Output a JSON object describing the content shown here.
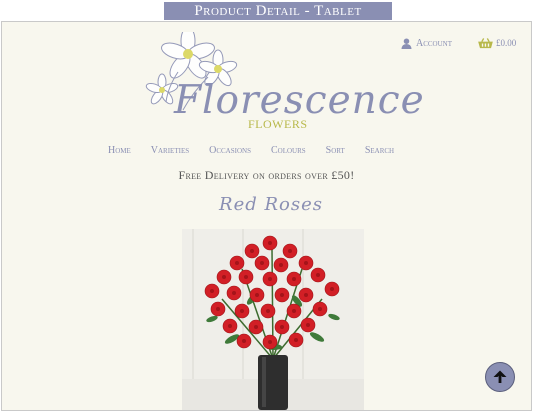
{
  "banner": "Product Detail - Tablet",
  "brand": {
    "name": "Florescence",
    "sub": "FLOWERS"
  },
  "header": {
    "account_label": "Account",
    "cart_amount": "£0.00"
  },
  "nav": {
    "items": [
      "Home",
      "Varieties",
      "Occasions",
      "Colours",
      "Sort",
      "Search"
    ]
  },
  "promo": "Free Delivery on orders over £50!",
  "product": {
    "title": "Red Roses"
  },
  "icons": {
    "account": "user-icon",
    "cart": "basket-icon",
    "scroll": "arrow-up-icon",
    "logo": "flower-logo-icon"
  },
  "colors": {
    "accent": "#8a8fb3",
    "gold": "#b8b84a",
    "background": "#f8f7ee"
  }
}
